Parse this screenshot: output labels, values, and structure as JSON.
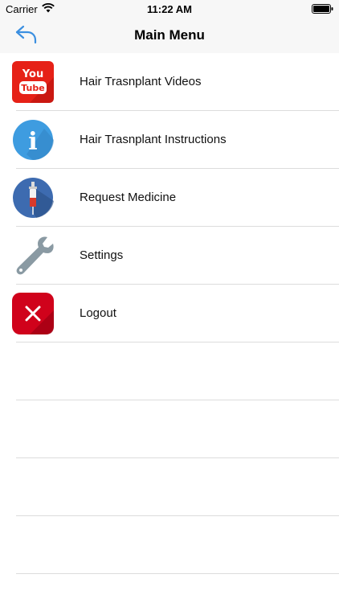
{
  "status_bar": {
    "carrier": "Carrier",
    "time": "11:22 AM",
    "wifi_icon": "wifi-icon",
    "battery_icon": "battery-icon"
  },
  "nav": {
    "title": "Main Menu",
    "back_icon": "back-arrow-icon"
  },
  "menu": {
    "items": [
      {
        "label": "Hair Trasnplant Videos",
        "icon": "youtube-icon",
        "icon_text_top": "You",
        "icon_text_bottom": "Tube"
      },
      {
        "label": "Hair Trasnplant Instructions",
        "icon": "info-icon",
        "icon_text": "i"
      },
      {
        "label": "Request Medicine",
        "icon": "syringe-icon"
      },
      {
        "label": "Settings",
        "icon": "wrench-icon"
      },
      {
        "label": "Logout",
        "icon": "logout-close-icon"
      }
    ]
  },
  "colors": {
    "accent": "#3b8fe0",
    "youtube_red": "#e62117",
    "info_blue": "#3e9ce0",
    "medicine_blue": "#3d6bb0",
    "wrench_gray": "#8a9aa3",
    "logout_red": "#d0021b"
  }
}
